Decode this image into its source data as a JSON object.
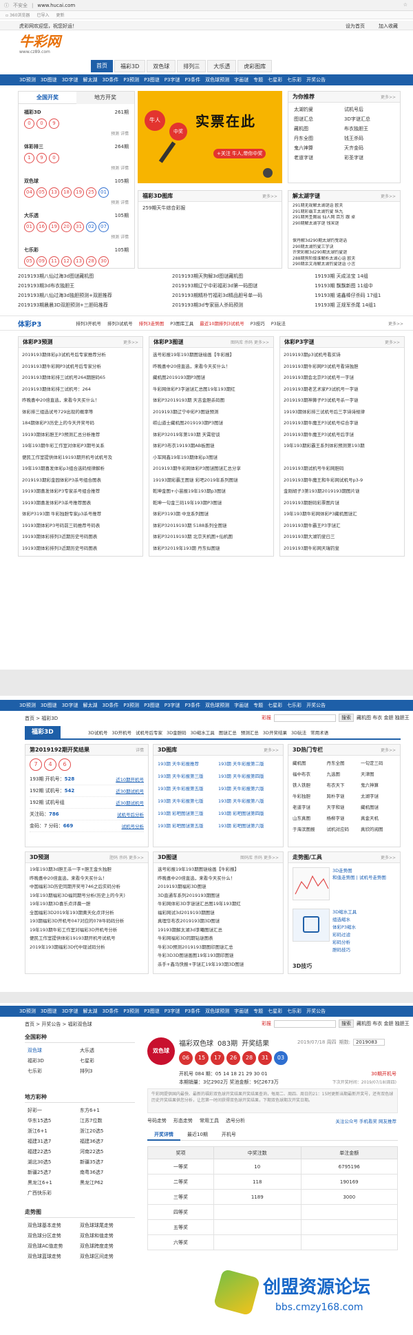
{
  "browser": {
    "security": "不安全",
    "url": "www.hucai.com",
    "bookmark1": "已导入",
    "bookmark2": "更新"
  },
  "top": {
    "welcome": "虎彩网欢迎您，祝您好运！",
    "set_home": "设为首页",
    "add_fav": "加入收藏",
    "logo": "牛彩网",
    "logo_sub": "www.cz89.com"
  },
  "main_tabs": [
    "首页",
    "福彩3D",
    "双色球",
    "排列三",
    "大乐透",
    "虎彩图库"
  ],
  "nav": [
    "3D预测",
    "3D图谜",
    "3D字谜",
    "解太湖",
    "3D条件",
    "P3预测",
    "P3图谜",
    "P3字谜",
    "P3条件",
    "双色球预测",
    "字画谜",
    "专题",
    "七星彩",
    "七乐彩",
    "开奖公告"
  ],
  "nav2": [
    "3D预测",
    "3D图谜",
    "3D字谜",
    "解太湖",
    "3D条件",
    "P3预测",
    "P3图谜",
    "P3字谜",
    "P3条件",
    "双色球预测",
    "字画谜",
    "专题",
    "七星彩",
    "七乐彩",
    "开奖公告"
  ],
  "lottery_panel": {
    "tab_national": "全国开奖",
    "tab_local": "地方开奖",
    "items": [
      {
        "name": "福彩3D",
        "issue": "261期",
        "balls": [
          "0",
          "0",
          "9"
        ],
        "links": "预测  详情"
      },
      {
        "name": "体彩排三",
        "issue": "264期",
        "balls": [
          "1",
          "9",
          "0"
        ],
        "links": "预测  详情"
      },
      {
        "name": "双色球",
        "issue": "105期",
        "balls": [
          "04",
          "05",
          "13",
          "18",
          "19",
          "25",
          "01"
        ],
        "links": "预测  详情"
      },
      {
        "name": "大乐透",
        "issue": "105期",
        "balls": [
          "01",
          "16",
          "19",
          "20",
          "31",
          "02",
          "07"
        ],
        "links": "预测  详情"
      },
      {
        "name": "七乐彩",
        "issue": "105期",
        "balls": [
          "05",
          "09",
          "11",
          "12",
          "13",
          "28",
          "30"
        ],
        "links": ""
      }
    ]
  },
  "banner": {
    "tag1": "牛人",
    "tag2": "中奖",
    "headline": "实票在此",
    "cta": "+关注  牛人,带你中奖"
  },
  "recommend": {
    "title": "为你推荐",
    "more": "更多>>",
    "items": [
      [
        "太湖钓叟",
        "试机号后"
      ],
      [
        "图谜汇总",
        "3D字谜汇总"
      ],
      [
        "藏机图",
        "布衣独胆王"
      ],
      [
        "丹东全图",
        "钱王杀码"
      ],
      [
        "鬼六神算",
        "天齐金码"
      ],
      [
        "老道字谜",
        "彩圣字谜"
      ]
    ]
  },
  "fc3d_gallery": {
    "title": "福彩3D图库",
    "more": "更多>>",
    "first": "259期天牛综合彩报"
  },
  "taihu": {
    "title": "解太湖字谜",
    "more": "更多>>",
    "items": [
      "291期无规解太湖谜语 欧夫",
      "291期彩霸王太湖钓叟 纵九",
      "291期黑圣图出 仙人网 百万 跟 卓",
      "290期解太湖字谜 钱宋谜",
      "",
      "",
      "保丹解3d290期太湖钓曳谜语",
      "290期太湖钓叟三字诀",
      "许荣彩解3d290期太湖钓叟谜",
      "288期狗阶级谁解析太湖心语 欧夫",
      "290期余文海解太湖钓叟谜语 小言",
      "289期董吾克太湖钓叟谜语 小玛鑫"
    ]
  },
  "band1_rows": [
    [
      "2019193期八仙过海3d图谜藏机图",
      "2019193期天狗解3d图谜藏机图",
      "19193期 天成法宝 14组"
    ],
    [
      "2019193期3d布衣独胆王",
      "2019193期辽宁中彩福彩3d第一码图谜",
      "19193期 飘飘新图 11组中"
    ],
    [
      "2019193期八仙过海3d独胆预测+双胆推荐",
      "2019193期精朴竹福彩3d精品胆号单一码",
      "19193期 诺鑫棒仔杀码 17组1"
    ],
    [
      "2019193期晨晨3D双胆预测+三胆码推荐",
      "2019193期3d专家丽人杀码预测",
      "19193期 正规军杀尾 14组1"
    ]
  ],
  "p3_section": {
    "title": "体彩P3",
    "tabs": [
      "排列3开机号",
      "排列3试机号",
      "排列3走势图",
      "P3图库工具",
      "最近10期排列3试机号",
      "P3技巧",
      "P3玩法"
    ],
    "more": "更多>>",
    "boxes": [
      {
        "title": "体彩P3预测",
        "more": "更多>>",
        "items": [
          "2019193期体彩p3试机号后专家推荐分析",
          "2019193期牛彩网P3试机号后专家分析",
          "2019193期体彩排三试机号264期胆码65",
          "2019193期体彩排三试机号：264",
          "昨晚喜中20倍直选，来看今天买什么！",
          "体彩排三组选试号729出现的概率等",
          "184期体彩P3历史上的今天开奖号码",
          "19193期体彩胆王P3预测汇总分析推荐",
          "19年193期牛彩工作室对体彩P3期号关系",
          "便民工作室提供体彩19193期开机号试机号及",
          "19年193期喜发体彩p3组合选码规律解析",
          "2019193期彩金园体彩P3杀号组合图表",
          "19193期喜发体彩P3专家杀号组合推荐",
          "19193期喜发体彩P3杀号推荐图表",
          "体彩P3193期 牛彩独胆专家p3杀号推荐",
          "19193期体彩P3号码前三码推荐号码表",
          "19193期体彩排列3近期历史号码图表",
          "19193期体彩排列3近期历史号码图表"
        ]
      },
      {
        "title": "体彩P3图谜",
        "tabs": "图码库  杀码  更多>>",
        "items": [
          "选号彩报19年193期图谜绘画【牛彩报】",
          "昨晚喜中20倍直选，来看今天买什么！",
          "藏机图2019193期P3图谜",
          "牛彩网体彩P3字迷谜汇总图19年193期红",
          "体彩P32019193期 天吉金胆杀码图",
          "2019193期辽宁中彩P3图谜预测",
          "崂山道士藏机图2019193期P3图谜",
          "体彩P32019年第193期 天霄密谈",
          "体彩P3布衣19193期AB板图谜",
          "小军网鑫19年193期体彩p3图谜",
          "2019193期牛彩网体彩P3图谜图谜汇总分享",
          "19193期彩霸王图谜 彩吧2019年系列图谜",
          "乾坤金图+小苗报19年193期p3图谜",
          "乾坤一句金三码19年193期P3图谜",
          "体彩P3193期 中龙系列图谜",
          "体彩P32019193期 5188系列全图谜",
          "体彩P32019193期 北京天机图+仙机图",
          "体彩P32019年193期 丹东似图谜"
        ]
      },
      {
        "title": "体彩P3字谜",
        "more": "更多>>",
        "items": [
          "2019193期p3试机号看买诗",
          "2019193期牛彩网P3试机号看诗独胆",
          "2019193期会北京P3试机号一字谜",
          "2019193期老艺术家P3试机号一字谜",
          "2019193期神算子P3试机号杀一字谜",
          "19193期体彩排三试机号后三字诗诗规律",
          "2019193期牛魔王P3试机号综合字谜",
          "2019193期牛魔王P3试机号后字谜",
          "19年193期彩霸王系列体彩预测第193期",
          "",
          "2019193期试机号牛彩网胆码",
          "2019193期牛魔王和牛彩网试机号p3-9",
          "金刚胡子3第193期2019193期图片谜",
          "2019193期胆码彩票图片谜",
          "19年193期牛彩网体彩P3藏机图谜汇",
          "2019193期牛霸王P3字谜汇",
          "2019193期大湖钓叟曰三",
          "2019193期牛彩网天瑞钓叟",
          "体彩p32019193期牛霸王诗谜",
          "19193期P3藏秋仁中和歌谜：要去不留 D：",
          "体彩P32019193期中彩王字谜",
          "2019193期体彩P3分解字谜"
        ]
      }
    ]
  },
  "fc3d_page": {
    "crumb": "首页 > 福彩3D",
    "search_label": "彩报",
    "search_btn": "搜索",
    "search_links": "藏机图  布衣  金胆  独胆王",
    "title": "福彩3D",
    "tabs": [
      "3D试机号",
      "3D开机号",
      "试机号后专家",
      "3D金胆码",
      "3D缩水工具",
      "图谜汇总",
      "预测汇总",
      "3D开奖结果",
      "3D玩法",
      "常用术语"
    ],
    "result": {
      "title": "第2019192期开奖结果",
      "detail": "详情",
      "balls": [
        "7",
        "4",
        "6"
      ],
      "rows": [
        {
          "label": "193期 开机号：",
          "value": "528",
          "link": "近10期开机号"
        },
        {
          "label": "192期 试机号：",
          "value": "542",
          "link": "近30期试机号"
        },
        {
          "label": "192期 试机号组",
          "value": "",
          "link": "近30期试机号"
        },
        {
          "label": "关注码：",
          "value": "786",
          "link": "试机号后分析"
        },
        {
          "label": "金码：7  分码：",
          "value": "669",
          "link": "试机号分析"
        }
      ]
    },
    "gallery": {
      "title": "3D图库",
      "more": "更多>>",
      "items": [
        [
          "193期 天牛彩报推荐",
          "193期 天牛彩报第二版"
        ],
        [
          "193期 天牛彩报第三版",
          "193期 天牛彩报第四版"
        ],
        [
          "193期 天牛彩报第五版",
          "193期 天牛彩报第六版"
        ],
        [
          "193期 天牛彩报第七版",
          "193期 天牛彩报第八版"
        ],
        [
          "193期 彩吧图谜第三版",
          "193期 彩吧图谜第四版"
        ],
        [
          "193期 彩吧图谜第五版",
          "193期 彩吧图谜第六版"
        ]
      ]
    },
    "expert": {
      "title": "3D热门专栏",
      "more": "更多>>",
      "items": [
        [
          "藏机图",
          "丹东全图",
          "一句定三码"
        ],
        [
          "福中布衣",
          "九选图",
          "天津图"
        ],
        [
          "铁人铁胆",
          "布衣天下",
          "鬼六神算"
        ],
        [
          "牛彩独胆",
          "跨朴字谜",
          "太湖字谜"
        ],
        [
          "老道字谜",
          "天宇和谜",
          "藏机图谜"
        ],
        [
          "山东真图",
          "杨柳字谜",
          "真金天机"
        ],
        [
          "于海滨图报",
          "试机对应码",
          "真欣的阅图"
        ]
      ]
    },
    "predict": {
      "title": "3D预测",
      "tabs": "胆码  杀码  更多>>",
      "items": [
        "19年193期3d胆王杀一字+胆王金头独胆",
        "昨晚喜中20倍直选，来看今天买什么！",
        "中国福彩3D历史同期开奖号746之后实码分析",
        "19年193期福彩3D福同期号分析(历史上的今天)",
        "19年193期3D喜乐点评晨一胆",
        "全国福彩3D2019年193期黄天化点评分析",
        "193期福彩3D开机号047对应的078牛码码分析",
        "19年193期牛彩工作室对福彩3D开机号分析",
        "便民工作室提供体彩19193期开机号试机号",
        "2019年193期福彩3D代中现试码分析"
      ]
    },
    "puzzle": {
      "title": "3D图谜",
      "tabs": "图码库  杀码  更多>>",
      "items": [
        "选号彩报19年193期图谜绘画【牛彩报】",
        "昨晚喜中20倍直选，来看今天买什么！",
        "2019193期福彩3D图谜",
        "3D直通车系列2019193期图谜",
        "牛彩网体彩3D字谜谜汇总图19年193期红",
        "福彩网试3d2019193期图谜",
        "真理华布衣2019193期3D图谜",
        "19193期解太湖3d李曦图谜汇总",
        "牛彩网福彩3D同期钻谜图表",
        "牛彩3D预测2019193期图印图谜汇总",
        "牛彩3D3D图谜画图19年193期印图谜",
        "杀手+鑫马快报+字谜汇19年193期3D图谜"
      ]
    },
    "tools": {
      "title": "走势图/工具",
      "more": "更多>>",
      "chart_label": "3D走势图",
      "chart_links": "和值走势图 | 试机号走势图",
      "cut_label": "3D缩水工具",
      "cut_links": [
        "组选缩水",
        "体彩P3缩水",
        "彩码过滤",
        "彩码分析",
        "胆码技巧"
      ],
      "cut_links2": [
        "缩水分析",
        "便民工具",
        "3D预测"
      ],
      "tips": "3D技巧"
    }
  },
  "ssq_page": {
    "crumb": "首页 > 开奖公告 > 福彩双色球",
    "search_label": "彩报",
    "search_btn": "搜索",
    "search_links": "藏机图  布衣  金胆  独胆王",
    "national": {
      "title": "全国彩种",
      "items": [
        [
          "双色球",
          "大乐透"
        ],
        [
          "福彩3D",
          "七星彩"
        ],
        [
          "七乐彩",
          "排列3"
        ]
      ]
    },
    "local": {
      "title": "地方彩种",
      "items": [
        [
          "好彩一",
          "东方6+1"
        ],
        [
          "华东15选5",
          "江苏7位数"
        ],
        [
          "浙江6+1",
          "浙江20选5"
        ],
        [
          "福建31选7",
          "福建36选7"
        ],
        [
          "福建22选5",
          "河南22选5"
        ],
        [
          "湖北30选5",
          "新疆35选7"
        ],
        [
          "新疆25选7",
          "南粤36选7"
        ],
        [
          "黑龙江6+1",
          "黑龙江P62"
        ],
        [
          "广西快乐彩",
          ""
        ]
      ]
    },
    "trend": {
      "title": "走势图",
      "items": [
        [
          "双色球基本走势",
          "双色球球尾走势"
        ],
        [
          "双色球分区走势",
          "双色球和值走势"
        ],
        [
          "双色球AC值走势",
          "双色球跨度走势"
        ],
        [
          "双色球蓝球走势",
          "双色球区间走势"
        ]
      ]
    },
    "header": {
      "logo": "双色球",
      "title": "福彩双色球",
      "issue": "083期",
      "title_suffix": "开奖结果",
      "date": "2019/07/18 周四",
      "period_label": "期数:",
      "period_value": "2019083"
    },
    "balls": [
      "06",
      "15",
      "17",
      "26",
      "28",
      "31",
      "03"
    ],
    "details": {
      "openings": "开机号  084   期：05  14  18  21  29  30  01",
      "today_line": "本期销量：3亿2902万  奖池金额：9亿2673万",
      "next_open": "下次开奖时间：2019/07/18(周四)",
      "trial": "30期开机号"
    },
    "desc": "牛彩网提供国内最快、最新的福彩双色球开奖结果开奖结果查询，每周二、周四、周日的21：15时更新当期最新开奖号，还有双色球历史开奖结果供您分析，让您第一时间获得双色球开奖结果，下期双色球期次开奖日期。",
    "tools": [
      "号码走势",
      "形态走势",
      "常用工具",
      "选号分析"
    ],
    "follow": "关注公众号 手机看奖 网友推荐",
    "result_tabs": [
      "开奖详情",
      "最近10期",
      "开机号"
    ],
    "table": {
      "headers": [
        "奖项",
        "中奖注数",
        "单注金额"
      ],
      "rows": [
        [
          "一等奖",
          "10",
          "6795196"
        ],
        [
          "二等奖",
          "118",
          "190169"
        ],
        [
          "三等奖",
          "1189",
          "3000"
        ],
        [
          "四等奖",
          "",
          ""
        ],
        [
          "五等奖",
          "",
          ""
        ],
        [
          "六等奖",
          "",
          ""
        ]
      ]
    }
  },
  "watermark": {
    "text": "创盟资源论坛",
    "url": "bbs.cmzy168.com"
  }
}
